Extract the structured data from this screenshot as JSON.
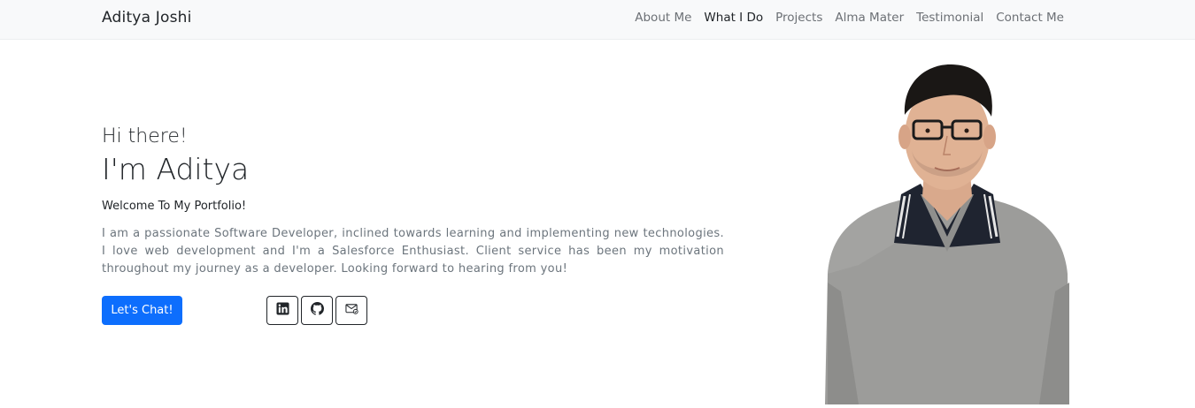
{
  "navbar": {
    "brand": "Aditya Joshi",
    "links": [
      {
        "label": "About Me",
        "active": false
      },
      {
        "label": "What I Do",
        "active": true
      },
      {
        "label": "Projects",
        "active": false
      },
      {
        "label": "Alma Mater",
        "active": false
      },
      {
        "label": "Testimonial",
        "active": false
      },
      {
        "label": "Contact Me",
        "active": false
      }
    ]
  },
  "hero": {
    "greeting": "Hi there!",
    "name": "I'm Aditya",
    "welcome": "Welcome To My Portfolio!",
    "bio": "I am a passionate Software Developer, inclined towards learning and implementing new technologies. I love web development and I'm a Salesforce Enthusiast. Client service has been my motivation throughout my journey as a developer. Looking forward to hearing from you!",
    "cta_label": "Let's Chat!",
    "social": [
      {
        "icon": "linkedin-icon"
      },
      {
        "icon": "github-icon"
      },
      {
        "icon": "mail-icon"
      }
    ]
  },
  "colors": {
    "primary": "#0d6efd",
    "nav_bg": "#f8f9fa",
    "muted": "#6c757d",
    "sweater": "#9a9a98"
  }
}
